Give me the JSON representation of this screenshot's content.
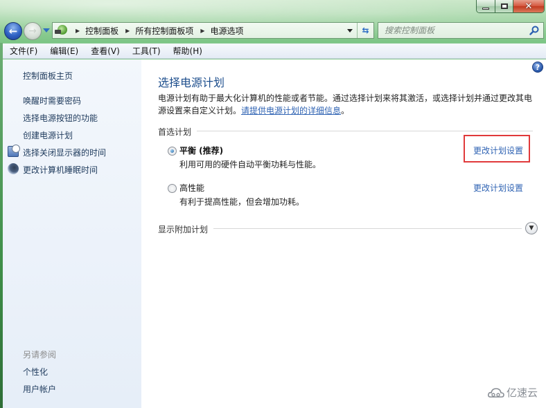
{
  "window": {
    "caption": {
      "minimize_icon": "minimize-icon",
      "maximize_icon": "maximize-icon",
      "close_icon": "close-icon"
    }
  },
  "nav": {
    "back_icon": "back-arrow-icon",
    "forward_icon": "forward-arrow-icon",
    "breadcrumbs": [
      "控制面板",
      "所有控制面板项",
      "电源选项"
    ],
    "search_placeholder": "搜索控制面板"
  },
  "menubar": {
    "items": [
      "文件(F)",
      "编辑(E)",
      "查看(V)",
      "工具(T)",
      "帮助(H)"
    ]
  },
  "sidebar": {
    "home": "控制面板主页",
    "tasks": [
      {
        "label": "唤醒时需要密码",
        "icon": null
      },
      {
        "label": "选择电源按钮的功能",
        "icon": null
      },
      {
        "label": "创建电源计划",
        "icon": null
      },
      {
        "label": "选择关闭显示器的时间",
        "icon": "monitor-clock-icon"
      },
      {
        "label": "更改计算机睡眠时间",
        "icon": "moon-icon"
      }
    ],
    "see_also_heading": "另请参阅",
    "see_also": [
      "个性化",
      "用户帐户"
    ]
  },
  "main": {
    "title": "选择电源计划",
    "description": "电源计划有助于最大化计算机的性能或者节能。通过选择计划来将其激活，或选择计划并通过更改其电源设置来自定义计划。",
    "description_link": "请提供电源计划的详细信息",
    "description_end": "。",
    "preferred_heading": "首选计划",
    "plans": [
      {
        "name": "平衡 (推荐)",
        "description": "利用可用的硬件自动平衡功耗与性能。",
        "selected": true,
        "change_link": "更改计划设置",
        "highlighted": true
      },
      {
        "name": "高性能",
        "description": "有利于提高性能，但会增加功耗。",
        "selected": false,
        "change_link": "更改计划设置",
        "highlighted": false
      }
    ],
    "additional_heading": "显示附加计划",
    "highlight_color": "#e0393a",
    "link_color": "#2f63b3",
    "title_color": "#1c4d8c"
  },
  "watermark": "亿速云"
}
